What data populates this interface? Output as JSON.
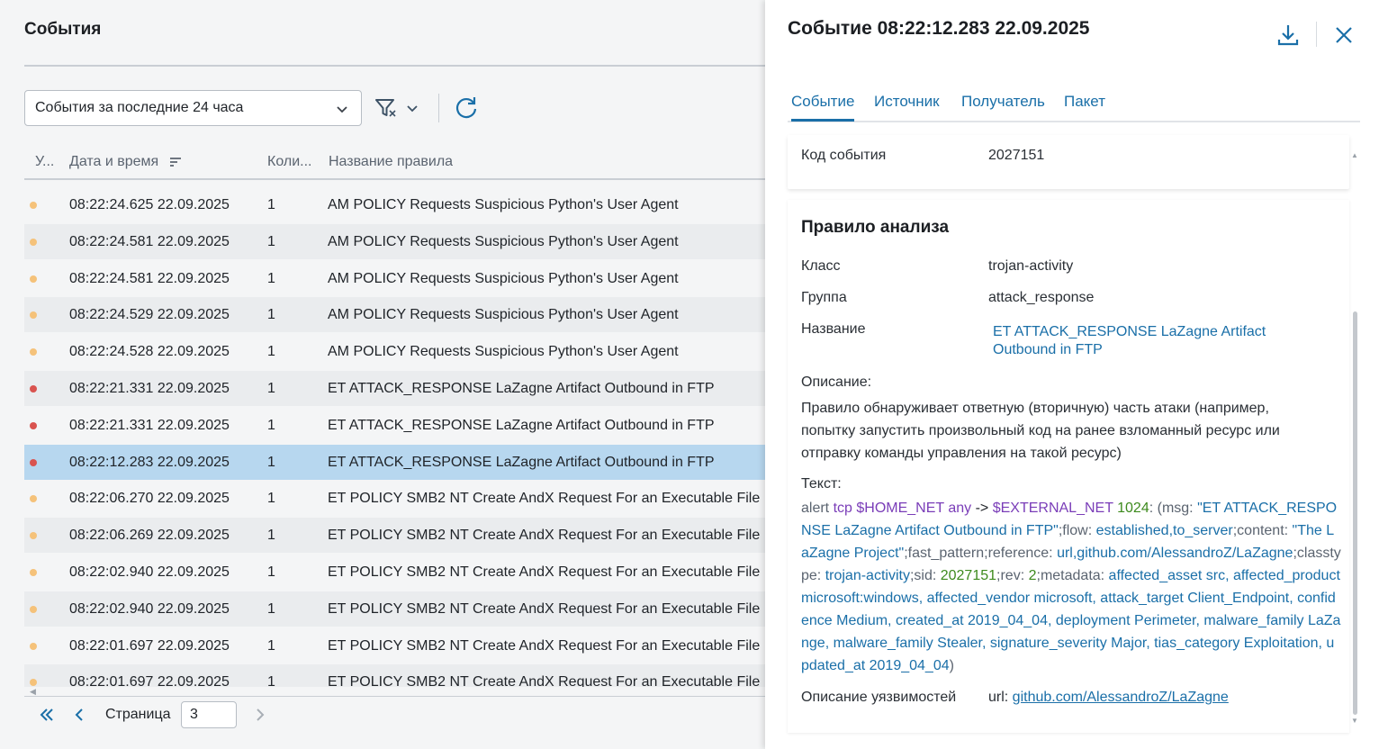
{
  "events_panel": {
    "title": "События",
    "period_select": {
      "value": "События за последние 24 часа"
    },
    "columns": {
      "level": "У...",
      "datetime": "Дата и время",
      "count": "Коли...",
      "rule_name": "Название правила"
    },
    "colors": {
      "warning": "#f5c27a",
      "critical": "#d9534f",
      "selected_row": "#b7d7ef",
      "accent": "#1a6fa8"
    },
    "rows": [
      {
        "level": "warning",
        "datetime": "08:22:24.625 22.09.2025",
        "count": "1",
        "rule": "AM POLICY Requests Suspicious Python's User Agent"
      },
      {
        "level": "warning",
        "datetime": "08:22:24.581 22.09.2025",
        "count": "1",
        "rule": "AM POLICY Requests Suspicious Python's User Agent"
      },
      {
        "level": "warning",
        "datetime": "08:22:24.581 22.09.2025",
        "count": "1",
        "rule": "AM POLICY Requests Suspicious Python's User Agent"
      },
      {
        "level": "warning",
        "datetime": "08:22:24.529 22.09.2025",
        "count": "1",
        "rule": "AM POLICY Requests Suspicious Python's User Agent"
      },
      {
        "level": "warning",
        "datetime": "08:22:24.528 22.09.2025",
        "count": "1",
        "rule": "AM POLICY Requests Suspicious Python's User Agent"
      },
      {
        "level": "critical",
        "datetime": "08:22:21.331 22.09.2025",
        "count": "1",
        "rule": "ET ATTACK_RESPONSE LaZagne Artifact Outbound in FTP"
      },
      {
        "level": "critical",
        "datetime": "08:22:21.331 22.09.2025",
        "count": "1",
        "rule": "ET ATTACK_RESPONSE LaZagne Artifact Outbound in FTP"
      },
      {
        "level": "critical",
        "datetime": "08:22:12.283 22.09.2025",
        "count": "1",
        "rule": "ET ATTACK_RESPONSE LaZagne Artifact Outbound in FTP",
        "selected": true
      },
      {
        "level": "warning",
        "datetime": "08:22:06.270 22.09.2025",
        "count": "1",
        "rule": "ET POLICY SMB2 NT Create AndX Request For an Executable File"
      },
      {
        "level": "warning",
        "datetime": "08:22:06.269 22.09.2025",
        "count": "1",
        "rule": "ET POLICY SMB2 NT Create AndX Request For an Executable File"
      },
      {
        "level": "warning",
        "datetime": "08:22:02.940 22.09.2025",
        "count": "1",
        "rule": "ET POLICY SMB2 NT Create AndX Request For an Executable File"
      },
      {
        "level": "warning",
        "datetime": "08:22:02.940 22.09.2025",
        "count": "1",
        "rule": "ET POLICY SMB2 NT Create AndX Request For an Executable File"
      },
      {
        "level": "warning",
        "datetime": "08:22:01.697 22.09.2025",
        "count": "1",
        "rule": "ET POLICY SMB2 NT Create AndX Request For an Executable File"
      },
      {
        "level": "warning",
        "datetime": "08:22:01.697 22.09.2025",
        "count": "1",
        "rule": "ET POLICY SMB2 NT Create AndX Request For an Executable File"
      }
    ],
    "pager": {
      "label": "Страница",
      "page": "3"
    }
  },
  "detail": {
    "title": "Событие 08:22:12.283 22.09.2025",
    "tabs": [
      {
        "label": "Событие",
        "active": true
      },
      {
        "label": "Источник"
      },
      {
        "label": "Получатель"
      },
      {
        "label": "Пакет"
      }
    ],
    "event_code": {
      "label": "Код события",
      "value": "2027151"
    },
    "rule": {
      "title": "Правило анализа",
      "class_label": "Класс",
      "class_value": "trojan-activity",
      "group_label": "Группа",
      "group_value": "attack_response",
      "name_label": "Название",
      "name_value": "ET ATTACK_RESPONSE LaZagne Artifact Outbound in FTP",
      "name_line1": "ET ATTACK_RESPONSE LaZagne Artifact",
      "name_line2": "Outbound in FTP",
      "description_label": "Описание:",
      "description": "Правило обнаруживает ответную (вторичную) часть атаки (например, попытку запустить произвольный код на ранее взломанный ресурс или отправку команды управления на такой ресурс)",
      "text_label": "Текст:",
      "text_parts": [
        {
          "t": "alert ",
          "k": "plain"
        },
        {
          "t": "tcp ",
          "k": "kw"
        },
        {
          "t": "$HOME_NET ",
          "k": "kw"
        },
        {
          "t": "any ",
          "k": "kw"
        },
        {
          "t": "-> ",
          "k": "dark"
        },
        {
          "t": "$EXTERNAL_NET ",
          "k": "kw"
        },
        {
          "t": "1024",
          "k": "num"
        },
        {
          "t": ": (msg: ",
          "k": "plain"
        },
        {
          "t": "\"ET ATTACK_RESPONSE LaZagne Artifact Outbound in FTP\"",
          "k": "val"
        },
        {
          "t": ";flow: ",
          "k": "plain"
        },
        {
          "t": "established,to_server",
          "k": "val"
        },
        {
          "t": ";content: ",
          "k": "plain"
        },
        {
          "t": "\"The LaZagne Project\"",
          "k": "val"
        },
        {
          "t": ";fast_pattern;reference: ",
          "k": "plain"
        },
        {
          "t": "url,github.com/AlessandroZ/LaZagne",
          "k": "val"
        },
        {
          "t": ";classtype: ",
          "k": "plain"
        },
        {
          "t": "trojan-activity",
          "k": "val"
        },
        {
          "t": ";sid: ",
          "k": "plain"
        },
        {
          "t": "2027151",
          "k": "num"
        },
        {
          "t": ";rev: ",
          "k": "plain"
        },
        {
          "t": "2",
          "k": "num"
        },
        {
          "t": ";metadata: ",
          "k": "plain"
        },
        {
          "t": "affected_asset src, affected_product microsoft:windows, affected_vendor microsoft, attack_target Client_Endpoint, confidence Medium, created_at 2019_04_04, deployment Perimeter, malware_family LaZange, malware_family Stealer, signature_severity Major, tias_category Exploitation, updated_at 2019_04_04",
          "k": "val"
        },
        {
          "t": ")",
          "k": "plain"
        }
      ],
      "vuln_label": "Описание уязвимостей",
      "vuln_prefix": "url: ",
      "vuln_link": "github.com/AlessandroZ/LaZagne"
    }
  }
}
